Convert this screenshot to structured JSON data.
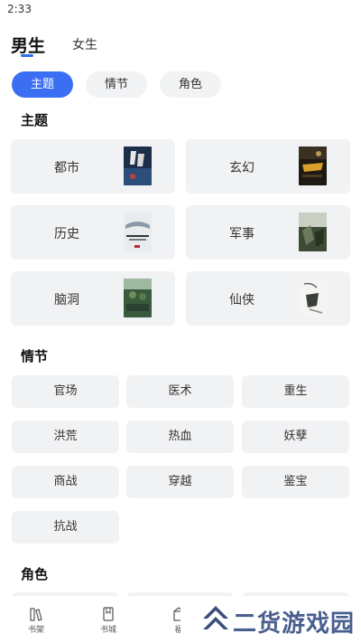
{
  "status": {
    "time": "2:33"
  },
  "gender_tabs": [
    {
      "label": "男生",
      "active": true
    },
    {
      "label": "女生",
      "active": false
    }
  ],
  "filters": [
    {
      "label": "主题",
      "active": true
    },
    {
      "label": "情节",
      "active": false
    },
    {
      "label": "角色",
      "active": false
    }
  ],
  "sections": {
    "theme_title": "主题",
    "plot_title": "情节",
    "role_title": "角色"
  },
  "themes": [
    {
      "label": "都市",
      "cover_icon": "book-cover-dark-blue"
    },
    {
      "label": "玄幻",
      "cover_icon": "book-cover-dark-gold"
    },
    {
      "label": "历史",
      "cover_icon": "book-cover-misty"
    },
    {
      "label": "军事",
      "cover_icon": "book-cover-green"
    },
    {
      "label": "脑洞",
      "cover_icon": "book-cover-army"
    },
    {
      "label": "仙侠",
      "cover_icon": "book-cover-ink"
    }
  ],
  "plots": [
    "官场",
    "医术",
    "重生",
    "洪荒",
    "热血",
    "妖孽",
    "商战",
    "穿越",
    "鉴宝",
    "抗战"
  ],
  "bottom_nav": [
    {
      "label": "书架",
      "icon": "bookshelf-icon"
    },
    {
      "label": "书城",
      "icon": "bookstore-icon"
    },
    {
      "label": "福",
      "icon": "gift-icon"
    }
  ],
  "watermark": {
    "text": "二货游戏园",
    "logo": "chevron-logo-icon"
  },
  "colors": {
    "accent": "#3a6ff3",
    "card_bg": "#f1f2f4",
    "watermark": "#4a5f8f"
  }
}
